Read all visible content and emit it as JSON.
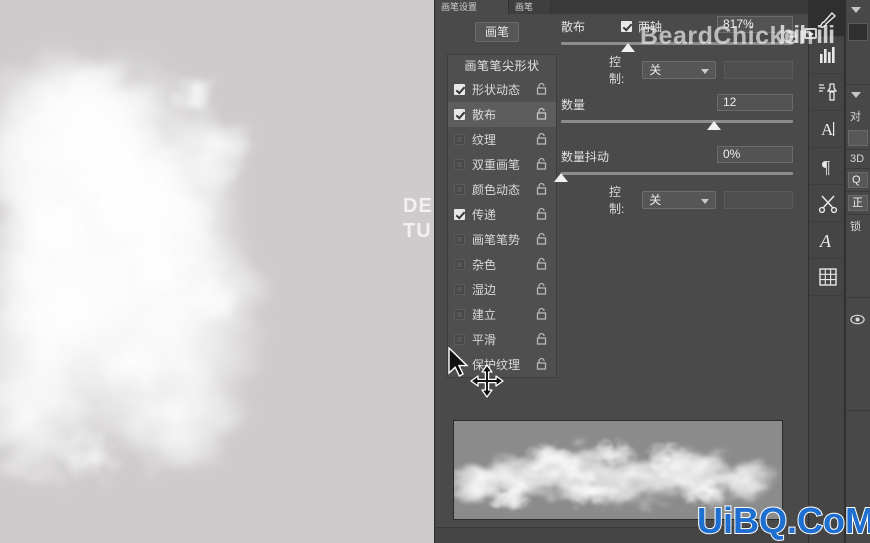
{
  "app": {
    "canvas_text_line1": "DE",
    "canvas_text_line2": "TU"
  },
  "panel": {
    "tabs": [
      {
        "label": "画笔设置"
      },
      {
        "label": "画笔"
      },
      {
        "label": ""
      }
    ],
    "brush_toggle_label": "画笔",
    "options_header": "画笔笔尖形状",
    "options": [
      {
        "label": "形状动态",
        "checked": true,
        "selected": false,
        "lock": "lock-icon"
      },
      {
        "label": "散布",
        "checked": true,
        "selected": true,
        "lock": "lock-icon"
      },
      {
        "label": "纹理",
        "checked": false,
        "selected": false,
        "lock": "lock-icon"
      },
      {
        "label": "双重画笔",
        "checked": false,
        "selected": false,
        "lock": "lock-icon"
      },
      {
        "label": "颜色动态",
        "checked": false,
        "selected": false,
        "lock": "lock-icon"
      },
      {
        "label": "传递",
        "checked": true,
        "selected": false,
        "lock": "lock-icon"
      },
      {
        "label": "画笔笔势",
        "checked": false,
        "selected": false,
        "lock": "lock-icon"
      },
      {
        "label": "杂色",
        "checked": false,
        "selected": false,
        "lock": "lock-icon"
      },
      {
        "label": "湿边",
        "checked": false,
        "selected": false,
        "lock": "lock-icon"
      },
      {
        "label": "建立",
        "checked": false,
        "selected": false,
        "lock": "lock-icon"
      },
      {
        "label": "平滑",
        "checked": false,
        "selected": false,
        "lock": "lock-icon"
      },
      {
        "label": "保护纹理",
        "checked": false,
        "selected": false,
        "lock": "lock-icon"
      }
    ],
    "controls": {
      "scatter": {
        "label": "散布",
        "both_axes_label": "两轴",
        "both_axes_checked": true,
        "value": "817%",
        "slider_percent": 33
      },
      "scatter_control": {
        "label": "控制:",
        "value": "关"
      },
      "count": {
        "label": "数量",
        "value": "12",
        "slider_percent": 63
      },
      "count_jitter": {
        "label": "数量抖动",
        "value": "0%",
        "slider_percent": 0
      },
      "count_jitter_control": {
        "label": "控制:",
        "value": "关"
      }
    }
  },
  "toolbar": {
    "items": [
      {
        "name": "brush-tool",
        "active": true
      },
      {
        "name": "histogram-tool",
        "active": false
      },
      {
        "name": "clone-stamp-tool",
        "active": false
      },
      {
        "name": "type-tool",
        "active": false
      },
      {
        "name": "paragraph-tool",
        "active": false
      },
      {
        "name": "scissors-tool",
        "active": false
      },
      {
        "name": "script-a-tool",
        "active": false
      },
      {
        "name": "grid-tool",
        "active": false
      }
    ]
  },
  "right_dock": {
    "sections": [
      {
        "text": ""
      },
      {
        "text": "对"
      },
      {
        "text": "3D"
      },
      {
        "text": "Q"
      },
      {
        "text": "正"
      },
      {
        "text": "锁"
      },
      {
        "text": ""
      }
    ]
  },
  "watermarks": {
    "beardchicken": "BeardChicken",
    "bilibili_left": "bil",
    "bilibili_right": "ili",
    "uibq": "UiBQ.CoM"
  }
}
